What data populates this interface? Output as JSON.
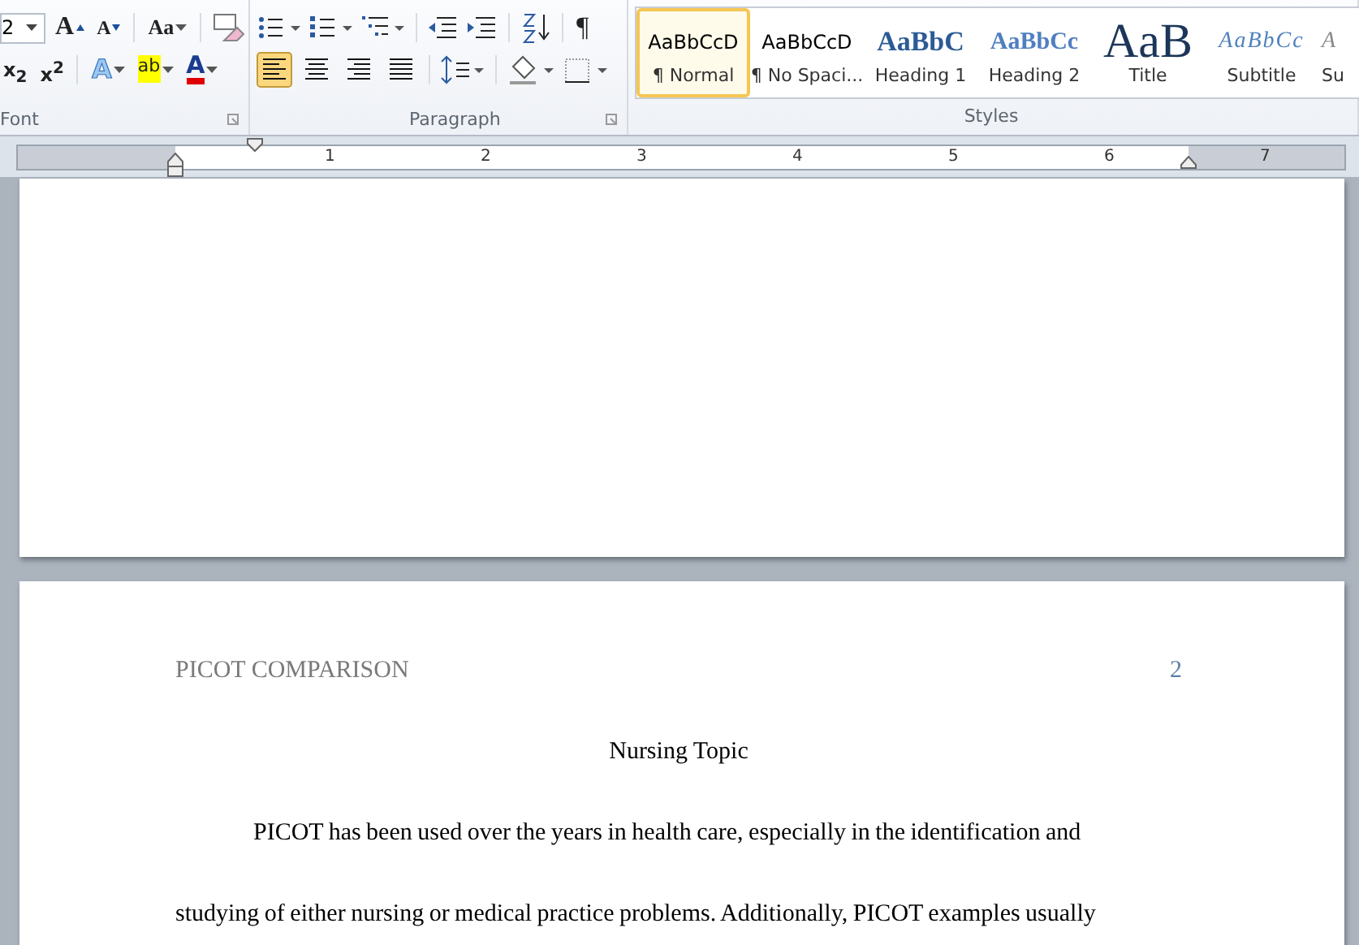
{
  "ribbon": {
    "font": {
      "size": "2",
      "grow": "A",
      "shrink": "A",
      "change_case": "Aa",
      "subscript": "x$_{2}$",
      "superscript": "x$^{2}$",
      "text_effect": "A",
      "highlight": "ab",
      "font_color": "A",
      "label": "Font"
    },
    "paragraph": {
      "pilcrow": "¶",
      "label": "Paragraph",
      "alignments": [
        {
          "kind": "left",
          "selected": true
        },
        {
          "kind": "center",
          "selected": false
        },
        {
          "kind": "right",
          "selected": false
        },
        {
          "kind": "justify",
          "selected": false
        }
      ]
    },
    "styles": {
      "label": "Styles",
      "items": [
        {
          "kind": "normal",
          "preview": "AaBbCcD",
          "label": "¶ Normal",
          "selected": true
        },
        {
          "kind": "normal",
          "preview": "AaBbCcD",
          "label": "¶ No Spaci...",
          "selected": false
        },
        {
          "kind": "heading1",
          "preview": "AaBbC",
          "label": "Heading 1",
          "selected": false
        },
        {
          "kind": "heading2",
          "preview": "AaBbCc",
          "label": "Heading 2",
          "selected": false
        },
        {
          "kind": "title",
          "preview": "AaB",
          "label": "Title",
          "selected": false
        },
        {
          "kind": "subtitle",
          "preview": "AaBbCc",
          "label": "Subtitle",
          "selected": false
        },
        {
          "kind": "subtle",
          "preview": "A",
          "label": "Su",
          "selected": false
        }
      ]
    }
  },
  "ruler": {
    "numbers": [
      "1",
      "2",
      "3",
      "4",
      "5",
      "6",
      "7"
    ]
  },
  "page": {
    "header": "PICOT COMPARISON",
    "page_number": "2",
    "heading": "Nursing Topic",
    "lines": [
      {
        "text": "PICOT has been used over the years in health care, especially in the identification and",
        "indent": true
      },
      {
        "text": "studying of either nursing or medical practice problems. Additionally, PICOT examples usually",
        "indent": false
      }
    ]
  }
}
